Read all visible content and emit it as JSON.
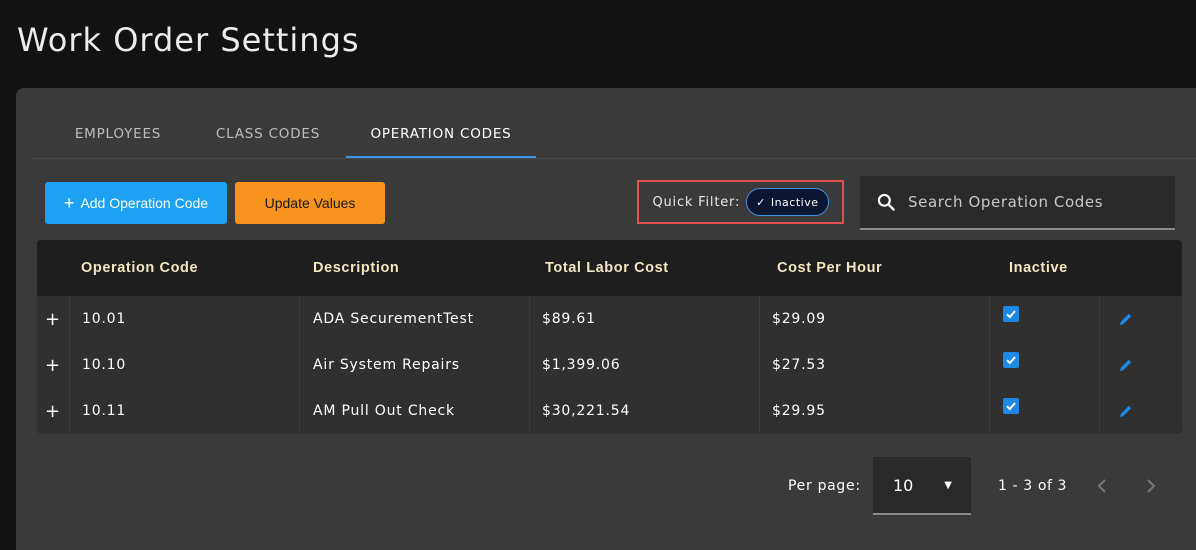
{
  "page": {
    "title": "Work Order Settings"
  },
  "tabs": [
    {
      "label": "EMPLOYEES"
    },
    {
      "label": "CLASS CODES"
    },
    {
      "label": "OPERATION CODES"
    }
  ],
  "toolbar": {
    "add_icon": "+",
    "add_label": "Add Operation Code",
    "update_label": "Update Values",
    "quick_filter_label": "Quick Filter:",
    "chip_check": "✓",
    "chip_label": "Inactive",
    "search_placeholder": "Search Operation Codes"
  },
  "table": {
    "headers": {
      "code": "Operation Code",
      "description": "Description",
      "total": "Total Labor Cost",
      "cph": "Cost Per Hour",
      "inactive": "Inactive"
    },
    "expand_icon": "+",
    "rows": [
      {
        "code": "10.01",
        "description": "ADA SecurementTest",
        "total": "$89.61",
        "cph": "$29.09",
        "inactive": true
      },
      {
        "code": "10.10",
        "description": "Air System Repairs",
        "total": "$1,399.06",
        "cph": "$27.53",
        "inactive": true
      },
      {
        "code": "10.11",
        "description": "AM Pull Out Check",
        "total": "$30,221.54",
        "cph": "$29.95",
        "inactive": true
      }
    ]
  },
  "pagination": {
    "per_page_label": "Per page:",
    "per_page_value": "10",
    "dropdown_arrow": "▼",
    "range": "1 - 3 of 3"
  },
  "colors": {
    "accent": "#3d93e8",
    "add_button": "#1da1f2",
    "update_button": "#f7931e",
    "highlight_border": "#e05252",
    "checkbox": "#1e88e5"
  },
  "icons": {
    "search": "search-icon",
    "edit": "pencil-icon",
    "check": "checkmark-icon",
    "prev": "chevron-left-icon",
    "next": "chevron-right-icon"
  }
}
